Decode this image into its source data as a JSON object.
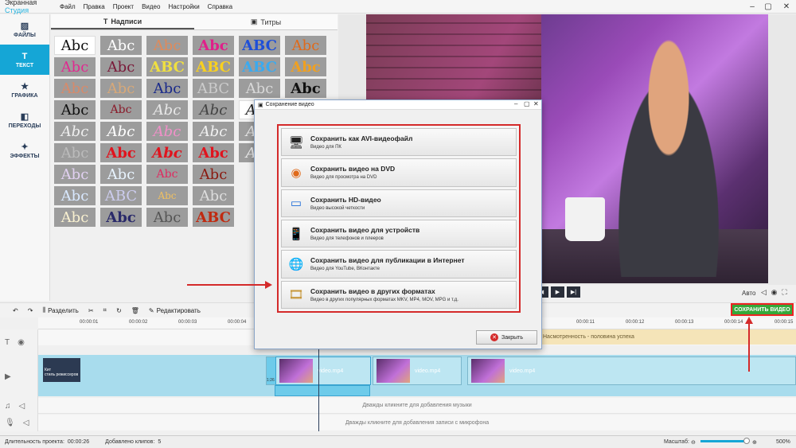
{
  "app": {
    "title_prefix": "Экранная ",
    "title_accent": "Студия"
  },
  "menu": [
    "Файл",
    "Правка",
    "Проект",
    "Видео",
    "Настройки",
    "Справка"
  ],
  "sidebar": {
    "items": [
      {
        "label": "ФАЙЛЫ",
        "icon": "image-icon"
      },
      {
        "label": "ТЕКСТ",
        "icon": "text-icon",
        "active": true
      },
      {
        "label": "ГРАФИКА",
        "icon": "star-icon"
      },
      {
        "label": "ПЕРЕХОДЫ",
        "icon": "transitions-icon"
      },
      {
        "label": "ЭФФЕКТЫ",
        "icon": "wand-icon"
      }
    ]
  },
  "tabs": {
    "captions": "Надписи",
    "titles": "Титры"
  },
  "styles": {
    "sample_text": "Abc",
    "sample_text_caps": "ABC"
  },
  "player": {
    "auto_label": "Авто"
  },
  "toolbar": {
    "split": "Разделить",
    "edit": "Редактировать",
    "save_video": "СОХРАНИТЬ ВИДЕО"
  },
  "ruler": {
    "ticks_left": [
      "00:00:01",
      "00:00:02",
      "00:00:03",
      "00:00:04"
    ],
    "ticks_right": [
      "00:00:11",
      "00:00:12",
      "00:00:13",
      "00:00:14",
      "00:00:15"
    ]
  },
  "timeline": {
    "text_clip": "Насмотренность - половина успеха",
    "dark_clip_line1": "Кит",
    "dark_clip_line2": "стиль режиссеров",
    "small_clip_time": "1:26",
    "clip_name": "video.mp4",
    "music_hint": "Дважды кликните для добавления музыки",
    "mic_hint": "Дважды кликните для добавления записи с микрофона"
  },
  "status": {
    "duration_label": "Длительность проекта:",
    "duration_value": "00:00:26",
    "clips_label": "Добавлено клипов:",
    "clips_value": "5",
    "zoom_label": "Масштаб:",
    "zoom_value": "500%"
  },
  "dialog": {
    "title": "Сохранение видео",
    "options": [
      {
        "title": "Сохранить как AVI-видеофайл",
        "subtitle": "Видео для ПК"
      },
      {
        "title": "Сохранить видео на DVD",
        "subtitle": "Видео для просмотра на DVD"
      },
      {
        "title": "Сохранить HD-видео",
        "subtitle": "Видео высокой четкости"
      },
      {
        "title": "Сохранить видео для устройств",
        "subtitle": "Видео для телефонов и плееров"
      },
      {
        "title": "Сохранить видео для публикации в Интернет",
        "subtitle": "Видео для YouTube, ВКонтакте"
      },
      {
        "title": "Сохранить видео в других форматах",
        "subtitle": "Видео в других популярных форматах MKV, MP4, MOV, MPG и т.д."
      }
    ],
    "close": "Закрыть"
  }
}
